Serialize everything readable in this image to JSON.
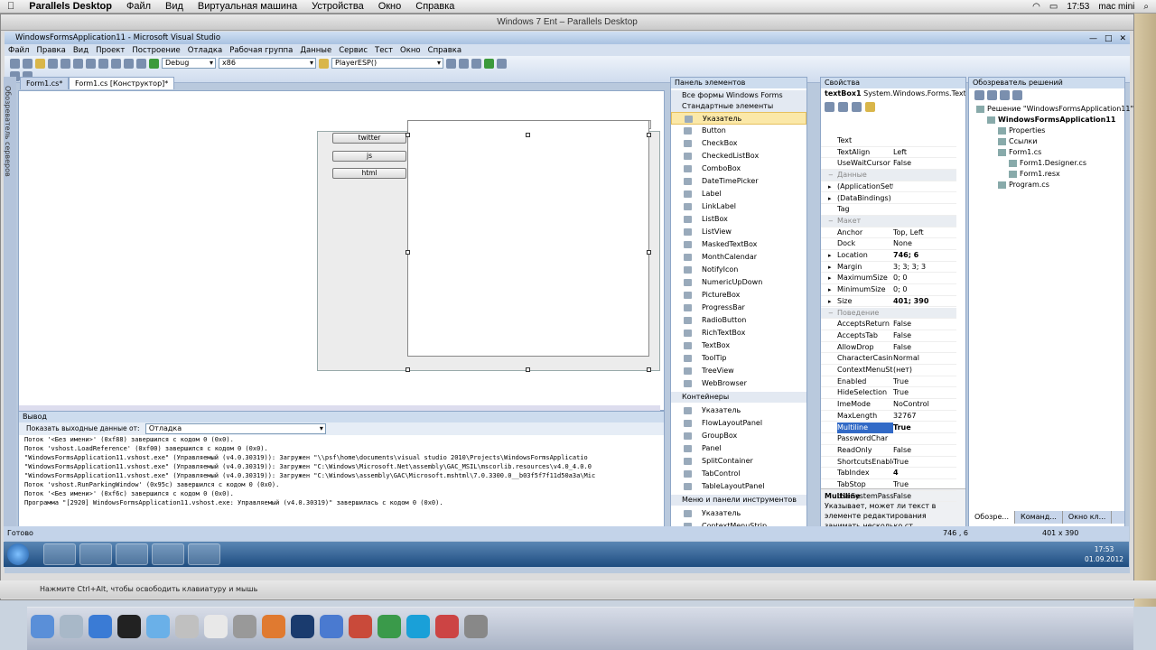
{
  "mac_menubar": {
    "app": "Parallels Desktop",
    "items": [
      "Файл",
      "Вид",
      "Виртуальная машина",
      "Устройства",
      "Окно",
      "Справка"
    ],
    "time": "17:53",
    "user": "mac mini"
  },
  "pd_window": {
    "title": "Windows 7 Ent – Parallels Desktop",
    "hint": "Нажмите Ctrl+Alt, чтобы освободить клавиатуру и мышь"
  },
  "vs": {
    "title": "WindowsFormsApplication11 - Microsoft Visual Studio",
    "menu": [
      "Файл",
      "Правка",
      "Вид",
      "Проект",
      "Построение",
      "Отладка",
      "Рабочая группа",
      "Данные",
      "Сервис",
      "Тест",
      "Окно",
      "Справка"
    ],
    "toolbar": {
      "config": "Debug",
      "platform": "x86",
      "find": "PlayerESP()"
    },
    "tabs": [
      "Form1.cs*",
      "Form1.cs [Конструктор]*"
    ],
    "left_strip": "Обозреватель серверов",
    "form_buttons": [
      "twitter",
      "js",
      "html"
    ],
    "status": "Готово",
    "status_location": "746 , 6",
    "status_size": "401 x 390"
  },
  "output": {
    "title": "Вывод",
    "show_label": "Показать выходные данные от:",
    "source": "Отладка",
    "lines": [
      "Поток '<Без имени>' (0xf88) завершился с кодом 0 (0x0).",
      "Поток 'vshost.LoadReference' (0xf00) завершился с кодом 0 (0x0).",
      "\"WindowsFormsApplication11.vshost.exe\" (Управляемый (v4.0.30319)): Загружен \"\\\\psf\\home\\documents\\visual studio 2010\\Projects\\WindowsFormsApplicatio",
      "\"WindowsFormsApplication11.vshost.exe\" (Управляемый (v4.0.30319)): Загружен \"C:\\Windows\\Microsoft.Net\\assembly\\GAC_MSIL\\mscorlib.resources\\v4.0_4.0.0",
      "\"WindowsFormsApplication11.vshost.exe\" (Управляемый (v4.0.30319)): Загружен \"C:\\Windows\\assembly\\GAC\\Microsoft.mshtml\\7.0.3300.0__b03f5f7f11d50a3a\\Mic",
      "Поток 'vshost.RunParkingWindow' (0x95c) завершился с кодом 0 (0x0).",
      "Поток '<Без имени>' (0xf6c) завершился с кодом 0 (0x0).",
      "Программа \"[2920] WindowsFormsApplication11.vshost.exe: Управляемый (v4.0.30319)\" завершилась с кодом 0 (0x0)."
    ]
  },
  "toolbox": {
    "title": "Панель элементов",
    "groups": [
      "Все формы Windows Forms",
      "Стандартные элементы управления",
      "Контейнеры",
      "Меню и панели инструментов"
    ],
    "standard": [
      "Указатель",
      "Button",
      "CheckBox",
      "CheckedListBox",
      "ComboBox",
      "DateTimePicker",
      "Label",
      "LinkLabel",
      "ListBox",
      "ListView",
      "MaskedTextBox",
      "MonthCalendar",
      "NotifyIcon",
      "NumericUpDown",
      "PictureBox",
      "ProgressBar",
      "RadioButton",
      "RichTextBox",
      "TextBox",
      "ToolTip",
      "TreeView",
      "WebBrowser"
    ],
    "containers": [
      "Указатель",
      "FlowLayoutPanel",
      "GroupBox",
      "Panel",
      "SplitContainer",
      "TabControl",
      "TableLayoutPanel"
    ],
    "menus": [
      "Указатель",
      "ContextMenuStrip"
    ]
  },
  "properties": {
    "title": "Свойства",
    "object": "textBox1",
    "object_type": "System.Windows.Forms.TextB",
    "rows": [
      {
        "n": "Text",
        "v": ""
      },
      {
        "n": "TextAlign",
        "v": "Left"
      },
      {
        "n": "UseWaitCursor",
        "v": "False"
      },
      {
        "n": "Данные",
        "v": "",
        "cat": true
      },
      {
        "n": "(ApplicationSetti",
        "v": "",
        "exp": true
      },
      {
        "n": "(DataBindings)",
        "v": "",
        "exp": true
      },
      {
        "n": "Tag",
        "v": ""
      },
      {
        "n": "Макет",
        "v": "",
        "cat": true
      },
      {
        "n": "Anchor",
        "v": "Top, Left"
      },
      {
        "n": "Dock",
        "v": "None"
      },
      {
        "n": "Location",
        "v": "746; 6",
        "exp": true,
        "bold": true
      },
      {
        "n": "Margin",
        "v": "3; 3; 3; 3",
        "exp": true
      },
      {
        "n": "MaximumSize",
        "v": "0; 0",
        "exp": true
      },
      {
        "n": "MinimumSize",
        "v": "0; 0",
        "exp": true
      },
      {
        "n": "Size",
        "v": "401; 390",
        "exp": true,
        "bold": true
      },
      {
        "n": "Поведение",
        "v": "",
        "cat": true
      },
      {
        "n": "AcceptsReturn",
        "v": "False"
      },
      {
        "n": "AcceptsTab",
        "v": "False"
      },
      {
        "n": "AllowDrop",
        "v": "False"
      },
      {
        "n": "CharacterCasing",
        "v": "Normal"
      },
      {
        "n": "ContextMenuStri",
        "v": "(нет)"
      },
      {
        "n": "Enabled",
        "v": "True"
      },
      {
        "n": "HideSelection",
        "v": "True"
      },
      {
        "n": "ImeMode",
        "v": "NoControl"
      },
      {
        "n": "MaxLength",
        "v": "32767"
      },
      {
        "n": "Multiline",
        "v": "True",
        "sel": true,
        "bold": true
      },
      {
        "n": "PasswordChar",
        "v": ""
      },
      {
        "n": "ReadOnly",
        "v": "False"
      },
      {
        "n": "ShortcutsEnablec",
        "v": "True"
      },
      {
        "n": "TabIndex",
        "v": "4",
        "bold": true
      },
      {
        "n": "TabStop",
        "v": "True"
      },
      {
        "n": "UseSystemPassw",
        "v": "False"
      }
    ],
    "desc_title": "Multiline",
    "desc_text": "Указывает, может ли текст в элементе редактирования занимать несколько ст..."
  },
  "solution": {
    "title": "Обозреватель решений",
    "items": [
      {
        "t": "Решение \"WindowsFormsApplication11\"",
        "lvl": 0
      },
      {
        "t": "WindowsFormsApplication11",
        "lvl": 1,
        "bold": true
      },
      {
        "t": "Properties",
        "lvl": 2
      },
      {
        "t": "Ссылки",
        "lvl": 2
      },
      {
        "t": "Form1.cs",
        "lvl": 2
      },
      {
        "t": "Form1.Designer.cs",
        "lvl": 3
      },
      {
        "t": "Form1.resx",
        "lvl": 3
      },
      {
        "t": "Program.cs",
        "lvl": 2
      }
    ],
    "tabs": [
      "Обозре...",
      "Команд...",
      "Окно кл..."
    ]
  },
  "win": {
    "time": "17:53",
    "date": "01.09.2012"
  }
}
